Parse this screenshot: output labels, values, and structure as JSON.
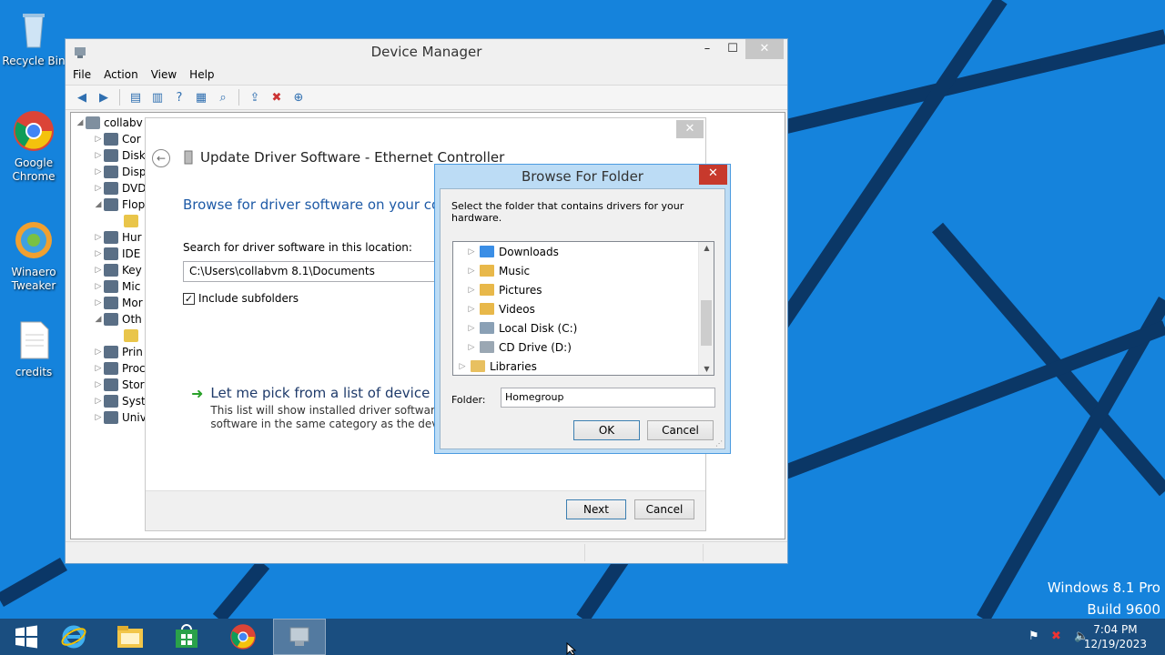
{
  "desktop": {
    "icons": [
      {
        "label": "Recycle Bin",
        "icon": "recycle-bin-icon"
      },
      {
        "label": "Google Chrome",
        "icon": "chrome-icon"
      },
      {
        "label": "Winaero Tweaker",
        "icon": "winaero-tweaker-icon"
      },
      {
        "label": "credits",
        "icon": "text-document-icon"
      }
    ],
    "watermark_line1": "Windows 8.1 Pro",
    "watermark_line2": "Build 9600"
  },
  "device_manager": {
    "title": "Device Manager",
    "window_buttons": {
      "minimize": "–",
      "maximize": "☐",
      "close": "✕"
    },
    "menu": [
      "File",
      "Action",
      "View",
      "Help"
    ],
    "toolbar_icons": [
      "back-icon",
      "forward-icon",
      "properties-icon",
      "update-icon",
      "help-icon",
      "details-icon",
      "scan-icon",
      "update-driver-icon",
      "disable-icon",
      "uninstall-icon"
    ],
    "tree": {
      "root": "collabv",
      "items": [
        {
          "label": "Cor",
          "expanded": false
        },
        {
          "label": "Disk",
          "expanded": false
        },
        {
          "label": "Disp",
          "expanded": false
        },
        {
          "label": "DVD",
          "expanded": false
        },
        {
          "label": "Flop",
          "expanded": true
        },
        {
          "label": "",
          "child": true
        },
        {
          "label": "Hur",
          "expanded": false
        },
        {
          "label": "IDE",
          "expanded": false
        },
        {
          "label": "Key",
          "expanded": false
        },
        {
          "label": "Mic",
          "expanded": false
        },
        {
          "label": "Mor",
          "expanded": false
        },
        {
          "label": "Oth",
          "expanded": true
        },
        {
          "label": "",
          "child": true
        },
        {
          "label": "Prin",
          "expanded": false
        },
        {
          "label": "Proc",
          "expanded": false
        },
        {
          "label": "Stor",
          "expanded": false
        },
        {
          "label": "Syst",
          "expanded": false
        },
        {
          "label": "Univ",
          "expanded": false
        }
      ]
    }
  },
  "update_driver": {
    "close": "✕",
    "title": "Update Driver Software - Ethernet Controller",
    "heading": "Browse for driver software on your com",
    "search_label": "Search for driver software in this location:",
    "path_value": "C:\\Users\\collabvm 8.1\\Documents",
    "include_subfolders": "Include subfolders",
    "include_subfolders_checked": true,
    "pick_title": "Let me pick from a list of device driv",
    "pick_desc_line1": "This list will show installed driver software com",
    "pick_desc_line2": "software in the same category as the device.",
    "next_button": "Next",
    "cancel_button": "Cancel"
  },
  "browse_folder": {
    "title": "Browse For Folder",
    "close": "✕",
    "instruction": "Select the folder that contains drivers for your hardware.",
    "folders": [
      {
        "label": "Downloads",
        "color": "#3a8ee6"
      },
      {
        "label": "Music",
        "color": "#e8b84a"
      },
      {
        "label": "Pictures",
        "color": "#e8b84a"
      },
      {
        "label": "Videos",
        "color": "#e8b84a"
      },
      {
        "label": "Local Disk (C:)",
        "color": "#8aa0b5"
      },
      {
        "label": "CD Drive (D:)",
        "color": "#9aa7b3"
      },
      {
        "label": "Libraries",
        "color": "#e8c060"
      }
    ],
    "folder_label": "Folder:",
    "folder_value": "Homegroup",
    "ok_button": "OK",
    "cancel_button": "Cancel"
  },
  "taskbar": {
    "items": [
      "start-icon",
      "internet-explorer-icon",
      "file-explorer-icon",
      "store-icon",
      "chrome-icon",
      "device-manager-icon"
    ],
    "tray_icons": [
      "action-center-flag-icon",
      "network-icon",
      "volume-icon"
    ],
    "time": "7:04 PM",
    "date": "12/19/2023"
  },
  "colors": {
    "desktop_bg": "#1583dc",
    "taskbar_bg": "#1a4e80",
    "link_blue": "#1e5aa6",
    "close_red": "#c7392c"
  }
}
